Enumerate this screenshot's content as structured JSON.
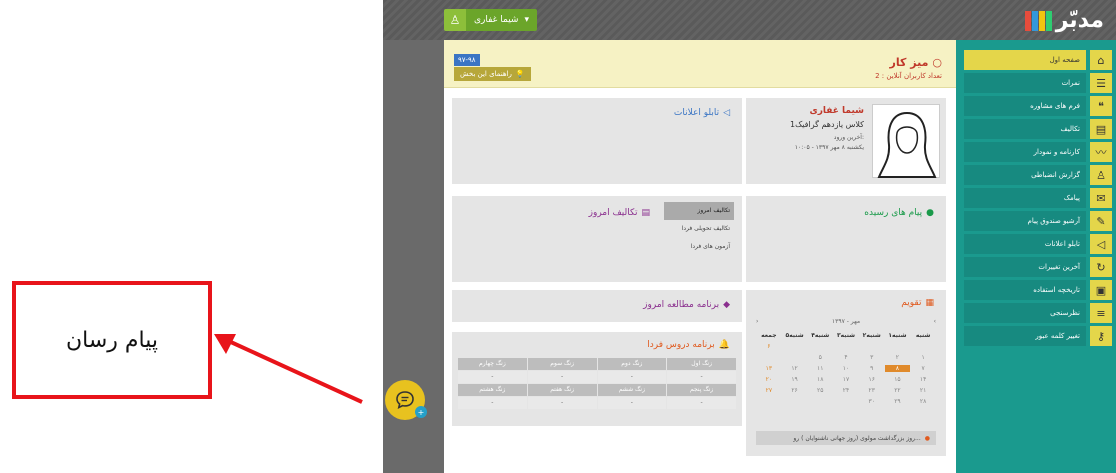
{
  "annotation": {
    "label": "پیام رسان"
  },
  "app": {
    "logo_text": "مدبّر",
    "brand_colors": [
      "#e74c3c",
      "#3498db",
      "#f1c40f",
      "#2ecc71"
    ],
    "user_name": "شیما غفاری"
  },
  "sidebar": {
    "items": [
      {
        "label": "صفحه اول",
        "icon": "home-icon",
        "glyph": "⌂",
        "active": true
      },
      {
        "label": "نمرات",
        "icon": "list-icon",
        "glyph": "☰"
      },
      {
        "label": "فرم های مشاوره",
        "icon": "chat-bubbles-icon",
        "glyph": "❝"
      },
      {
        "label": "تکالیف",
        "icon": "book-icon",
        "glyph": "▤"
      },
      {
        "label": "کارنامه و نمودار",
        "icon": "chart-icon",
        "glyph": "〰"
      },
      {
        "label": "گزارش انضباطی",
        "icon": "person-icon",
        "glyph": "♙"
      },
      {
        "label": "پیامک",
        "icon": "envelope-icon",
        "glyph": "✉"
      },
      {
        "label": "آرشیو صندوق پیام",
        "icon": "message-icon",
        "glyph": "✎"
      },
      {
        "label": "تابلو اعلانات",
        "icon": "megaphone-icon",
        "glyph": "◁"
      },
      {
        "label": "آخرین تغییرات",
        "icon": "refresh-icon",
        "glyph": "↻"
      },
      {
        "label": "تاریخچه استفاده",
        "icon": "archive-icon",
        "glyph": "▣"
      },
      {
        "label": "نظرسنجی",
        "icon": "survey-icon",
        "glyph": "≡"
      },
      {
        "label": "تغییر کلمه عبور",
        "icon": "key-icon",
        "glyph": "⚷"
      }
    ]
  },
  "desk": {
    "title": "میز کار",
    "online_users": "تعداد کاربران آنلاین : 2",
    "date_badge": "۹۷-۹۸",
    "help_label": "راهنمای این بخش"
  },
  "profile": {
    "name": "شیما غفاری",
    "class_name": "کلاس یازدهم گرافیک1",
    "last_login_label": "آخرین ورود:",
    "last_login_value": "یکشنبه ۸ مهر ۱۳۹۷ - ۱۰:۰۵"
  },
  "notice_board": {
    "title": "تابلو اعلانات"
  },
  "messages": {
    "title": "پیام های رسیده"
  },
  "homework": {
    "title": "تکالیف امروز",
    "tabs": [
      "تکالیف امروز",
      "تکالیف تحویلی فردا",
      "آزمون های فردا"
    ]
  },
  "study": {
    "title": "برنامه مطالعه امروز"
  },
  "schedule": {
    "title": "برنامه دروس فردا",
    "headers_row1": [
      "زنگ اول",
      "زنگ دوم",
      "زنگ سوم",
      "زنگ چهارم"
    ],
    "values_row1": [
      "-",
      "-",
      "-",
      "-"
    ],
    "headers_row2": [
      "زنگ پنجم",
      "زنگ ششم",
      "زنگ هفتم",
      "زنگ هشتم"
    ],
    "values_row2": [
      "-",
      "-",
      "-",
      "-"
    ]
  },
  "calendar": {
    "title": "تقویم",
    "month": "مهر - ۱۳۹۷",
    "prev": "‹",
    "next": "›",
    "weekdays": [
      "شنبه",
      "۱شنبه",
      "۲شنبه",
      "۳شنبه",
      "۴شنبه",
      "۵شنبه",
      "جمعه"
    ],
    "days": [
      "",
      "",
      "",
      "",
      "",
      "",
      "۶",
      "۱",
      "۲",
      "۳",
      "۴",
      "۵",
      "",
      "",
      "۷",
      "۸",
      "۹",
      "۱۰",
      "۱۱",
      "۱۲",
      "۱۳",
      "۱۴",
      "۱۵",
      "۱۶",
      "۱۷",
      "۱۸",
      "۱۹",
      "۲۰",
      "۲۱",
      "۲۲",
      "۲۳",
      "۲۴",
      "۲۵",
      "۲۶",
      "۲۷",
      "۲۸",
      "۲۹",
      "۳۰",
      "",
      "",
      "",
      ""
    ],
    "note": "روز بزرگداشت مولوی (روز جهانی ناشنوایان ) رو..."
  }
}
